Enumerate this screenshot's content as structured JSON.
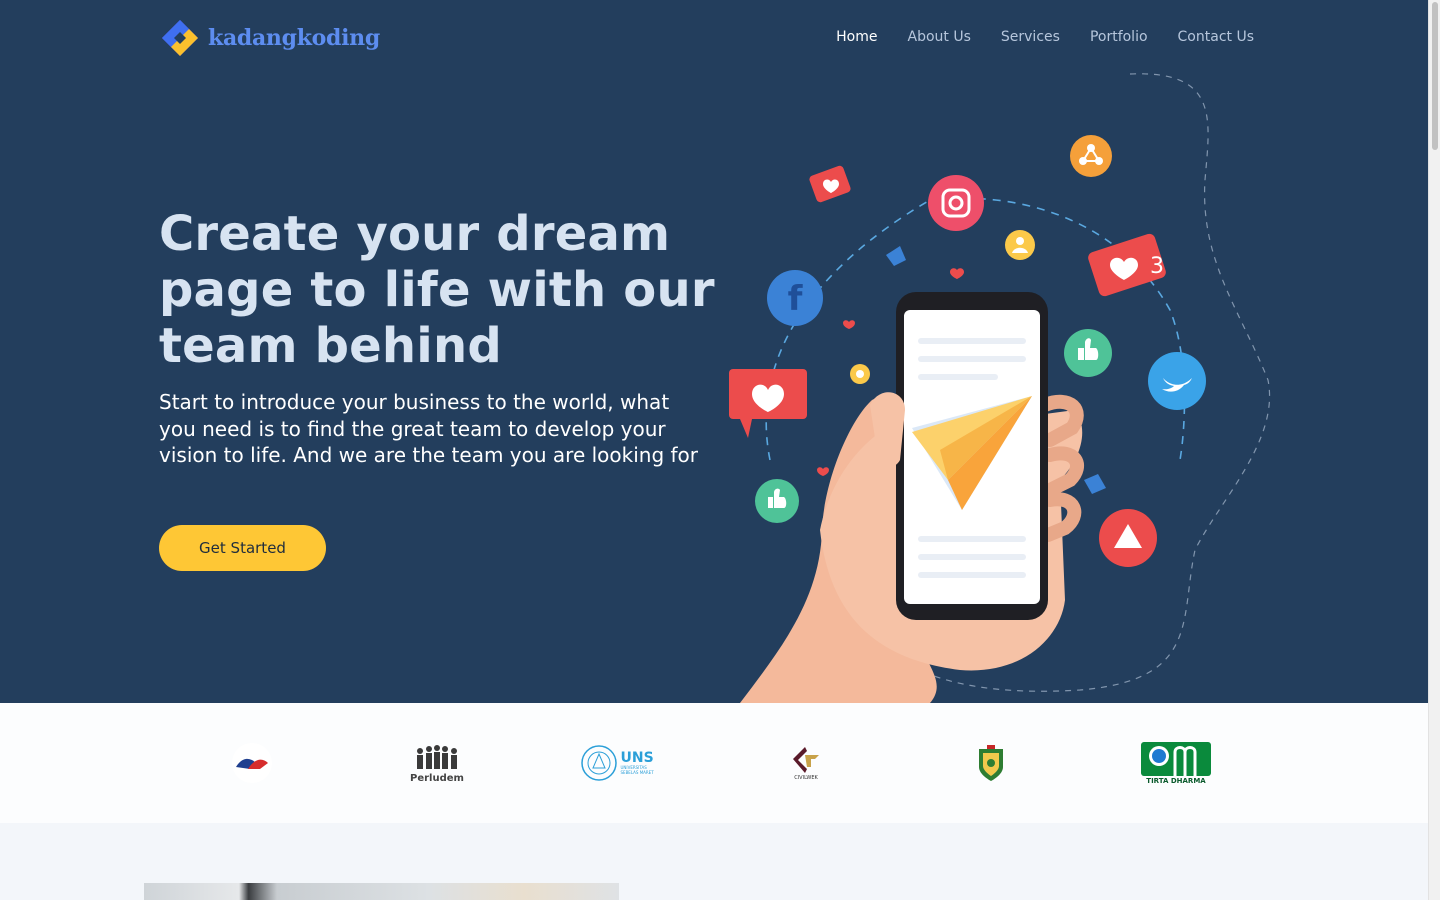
{
  "brand": {
    "name": "kadangkoding"
  },
  "nav": {
    "items": [
      {
        "label": "Home",
        "active": true
      },
      {
        "label": "About Us"
      },
      {
        "label": "Services"
      },
      {
        "label": "Portfolio"
      },
      {
        "label": "Contact Us"
      }
    ]
  },
  "hero": {
    "headline": "Create your dream page to life with our team behind",
    "subtext": "Start to introduce your business to the world, what you need is to find the great team to develop your vision to life. And we are the team you are looking for",
    "cta_label": "Get Started",
    "notification_count": "3"
  },
  "clients": {
    "logos": [
      {
        "name": "client-logo-1",
        "text": ""
      },
      {
        "name": "perludem",
        "text": "Perludem"
      },
      {
        "name": "uns",
        "text": "UNS",
        "subtext": "UNIVERSITAS SEBELAS MARET"
      },
      {
        "name": "civil-work",
        "text": "CIVILWEK"
      },
      {
        "name": "government-seal",
        "text": ""
      },
      {
        "name": "tirta-dharma",
        "text": "TIRTA DHARMA"
      }
    ]
  },
  "colors": {
    "hero_bg": "#233e5d",
    "accent": "#fec735",
    "brand": "#5d8df0"
  }
}
